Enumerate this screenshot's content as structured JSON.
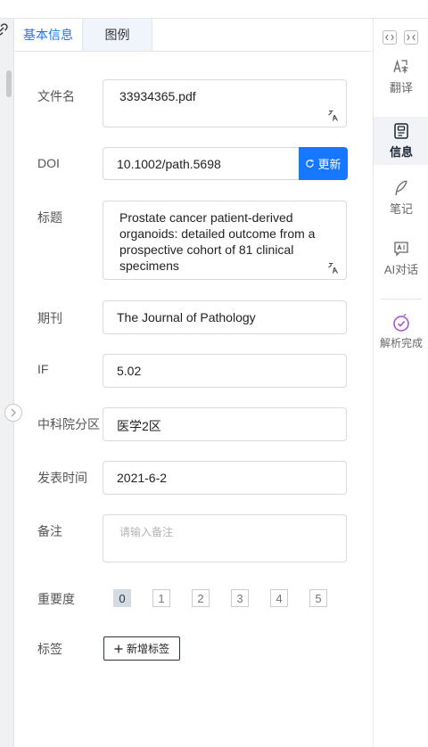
{
  "tabs": [
    {
      "label": "基本信息",
      "active": true
    },
    {
      "label": "图例",
      "active": false
    }
  ],
  "form": {
    "filename_label": "文件名",
    "filename_value": "33934365.pdf",
    "doi_label": "DOI",
    "doi_value": "10.1002/path.5698",
    "update_label": "更新",
    "title_label": "标题",
    "title_value": "Prostate cancer patient-derived\norganoids: detailed outcome from a\nprospective cohort of 81 clinical\nspecimens",
    "journal_label": "期刊",
    "journal_value": "The Journal of Pathology",
    "if_label": "IF",
    "if_value": "5.02",
    "cas_label": "中科院分区",
    "cas_value": "医学2区",
    "date_label": "发表时间",
    "date_value": "2021-6-2",
    "note_label": "备注",
    "note_placeholder": "请输入备注",
    "importance_label": "重要度",
    "importance_options": [
      "0",
      "1",
      "2",
      "3",
      "4",
      "5"
    ],
    "importance_selected": 0,
    "tags_label": "标签",
    "add_tag_label": "新增标签"
  },
  "sidebar": {
    "items": [
      {
        "label": "翻译",
        "icon": "translate-icon"
      },
      {
        "label": "信息",
        "icon": "info-doc-icon",
        "active": true
      },
      {
        "label": "笔记",
        "icon": "quill-icon"
      },
      {
        "label": "AI对话",
        "icon": "ai-chat-icon"
      },
      {
        "label": "解析完成",
        "icon": "check-circle-icon"
      }
    ]
  },
  "colors": {
    "accent": "#1677ff",
    "done": "#a44bd6"
  }
}
